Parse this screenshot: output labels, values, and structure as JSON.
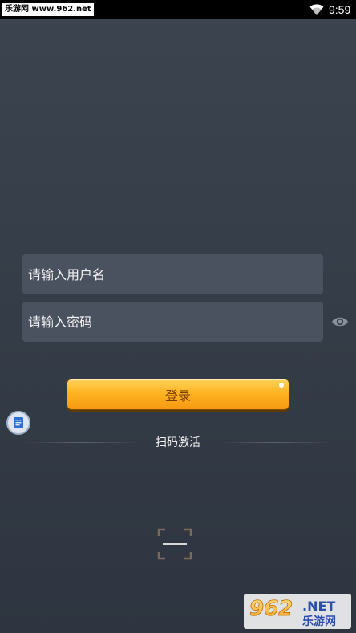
{
  "status_bar": {
    "watermark": "乐游网 www.962.net",
    "time": "9:59",
    "icons": [
      "wifi-icon"
    ]
  },
  "form": {
    "username_placeholder": "请输入用户名",
    "password_placeholder": "请输入密码",
    "password_toggle_icon": "eye-icon",
    "login_label": "登录",
    "login_color": "#ffb321"
  },
  "scan": {
    "label": "扫码激活",
    "icon": "scan-frame-icon"
  },
  "floating": {
    "icon": "document-icon"
  },
  "watermark_logo": {
    "brand": "962.NET",
    "subtitle": "乐游网"
  }
}
